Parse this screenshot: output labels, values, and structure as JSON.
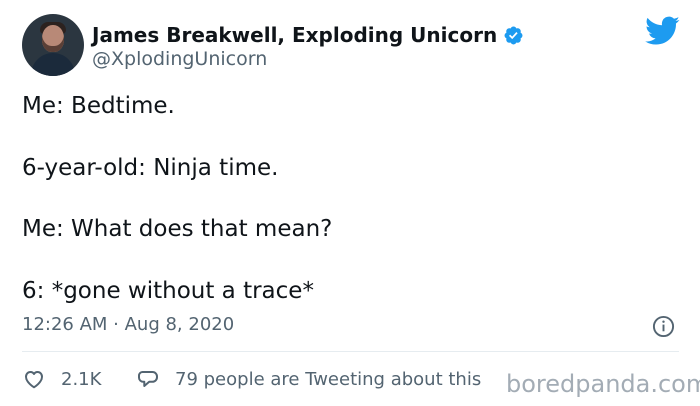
{
  "author": {
    "display_name": "James Breakwell, Exploding Unicorn",
    "handle": "@XplodingUnicorn",
    "avatar_icon": "author-portrait",
    "verified_icon": "verified-badge"
  },
  "platform": {
    "logo_icon": "twitter-bird-logo",
    "accent_color": "#1d9bf0"
  },
  "tweet": {
    "lines": [
      "Me: Bedtime.",
      "6-year-old: Ninja time.",
      "Me: What does that mean?",
      "6: *gone without a trace*"
    ]
  },
  "meta": {
    "timestamp": "12:26 AM · Aug 8, 2020",
    "info_icon": "info-icon"
  },
  "actions": {
    "likes": "2.1K",
    "reply_text": "79 people are Tweeting about this",
    "like_icon": "heart-icon",
    "reply_icon": "speech-bubble-icon"
  },
  "watermark": {
    "text": "boredpanda.com"
  }
}
